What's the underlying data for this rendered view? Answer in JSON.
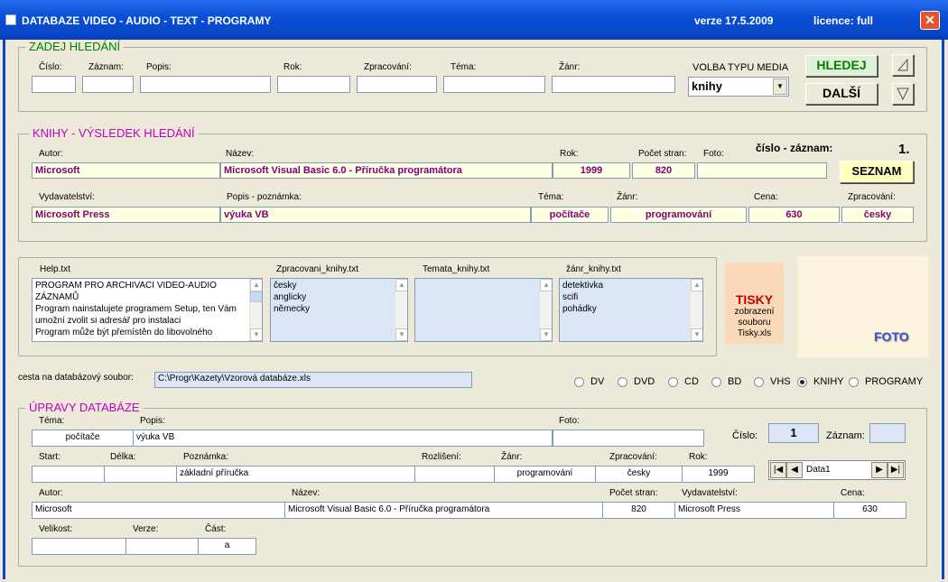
{
  "window": {
    "title": "DATABAZE  VIDEO - AUDIO - TEXT - PROGRAMY",
    "version": "verze 17.5.2009",
    "license": "licence: full",
    "close_glyph": "✕"
  },
  "search": {
    "group_title": "ZADEJ  HLEDÁNÍ",
    "labels": {
      "cislo": "Číslo:",
      "zaznam": "Záznam:",
      "popis": "Popis:",
      "rok": "Rok:",
      "zpracovani": "Zpracování:",
      "tema": "Téma:",
      "zanr": "Žánr:",
      "media": "VOLBA TYPU MEDIA"
    },
    "media_value": "knihy",
    "hledej": "HLEDEJ",
    "dalsi": "DALŠÍ"
  },
  "results": {
    "group_title": "KNIHY -  VÝSLEDEK HLEDÁNÍ",
    "record_label": "číslo - záznam:",
    "record_value": "1.",
    "seznam": "SEZNAM",
    "labels": {
      "autor": "Autor:",
      "nazev": "Název:",
      "rok": "Rok:",
      "pocet_stran": "Počet stran:",
      "foto": "Foto:",
      "vydavatelstvi": "Vydavatelství:",
      "popis": "Popis - poznámka:",
      "tema": "Téma:",
      "zanr": "Žánr:",
      "cena": "Cena:",
      "zpracovani": "Zpracování:"
    },
    "values": {
      "autor": "Microsoft",
      "nazev": "Microsoft Visual Basic 6.0 - Příručka programátora",
      "rok": "1999",
      "pocet_stran": "820",
      "foto": "",
      "vydavatelstvi": "Microsoft Press",
      "popis": "výuka VB",
      "tema": "počítače",
      "zanr": "programování",
      "cena": "630",
      "zpracovani": "česky"
    }
  },
  "files": {
    "help_label": "Help.txt",
    "help_lines": [
      "PROGRAM PRO ARCHIVACI VIDEO-AUDIO",
      "ZÁZNAMŮ",
      "Program nainstalujete programem Setup, ten Vám",
      "umožní zvolit si adresář pro instalaci",
      "Program může být přemístěn do libovolného"
    ],
    "zprac_label": "Zpracovani_knihy.txt",
    "zprac_lines": [
      "česky",
      "anglicky",
      "německy"
    ],
    "temata_label": "Temata_knihy.txt",
    "temata_lines": [],
    "zanr_label": "žánr_knihy.txt",
    "zanr_lines": [
      "detektivka",
      "scifi",
      "pohádky"
    ]
  },
  "tisky": {
    "title": "TISKY",
    "line1": "zobrazení",
    "line2": "souboru",
    "line3": "Tisky.xls"
  },
  "foto_label": "FOTO",
  "path": {
    "label": "cesta na databázový soubor:",
    "value": "C:\\Progr\\Kazety\\Vzorová databáze.xls"
  },
  "media_radios": [
    {
      "label": "DV",
      "checked": false
    },
    {
      "label": "DVD",
      "checked": false
    },
    {
      "label": "CD",
      "checked": false
    },
    {
      "label": "BD",
      "checked": false
    },
    {
      "label": "VHS",
      "checked": false
    },
    {
      "label": "KNIHY",
      "checked": true
    },
    {
      "label": "PROGRAMY",
      "checked": false
    }
  ],
  "edit": {
    "group_title": "ÚPRAVY DATABÁZE",
    "labels": {
      "tema": "Téma:",
      "popis": "Popis:",
      "foto": "Foto:",
      "cislo": "Číslo:",
      "zaznam": "Záznam:",
      "start": "Start:",
      "delka": "Délka:",
      "poznamka": "Poznámka:",
      "rozliseni": "Rozlišení:",
      "zanr": "Žánr:",
      "zpracovani": "Zpracování:",
      "rok": "Rok:",
      "autor": "Autor:",
      "nazev": "Název:",
      "pocet_stran": "Počet stran:",
      "vydavatelstvi": "Vydavatelství:",
      "cena": "Cena:",
      "velikost": "Velikost:",
      "verze": "Verze:",
      "cast": "Část:"
    },
    "values": {
      "tema": "počítače",
      "popis": "výuka VB",
      "foto": "",
      "cislo": "1",
      "zaznam": "",
      "start": "",
      "delka": "",
      "poznamka": "základní příručka",
      "rozliseni": "",
      "zanr": "programování",
      "zpracovani": "česky",
      "rok": "1999",
      "autor": "Microsoft",
      "nazev": "Microsoft Visual Basic 6.0 - Příručka programátora",
      "pocet_stran": "820",
      "vydavatelstvi": "Microsoft Press",
      "cena": "630",
      "velikost": "",
      "verze": "",
      "cast": "a"
    },
    "data_control": "Data1"
  }
}
